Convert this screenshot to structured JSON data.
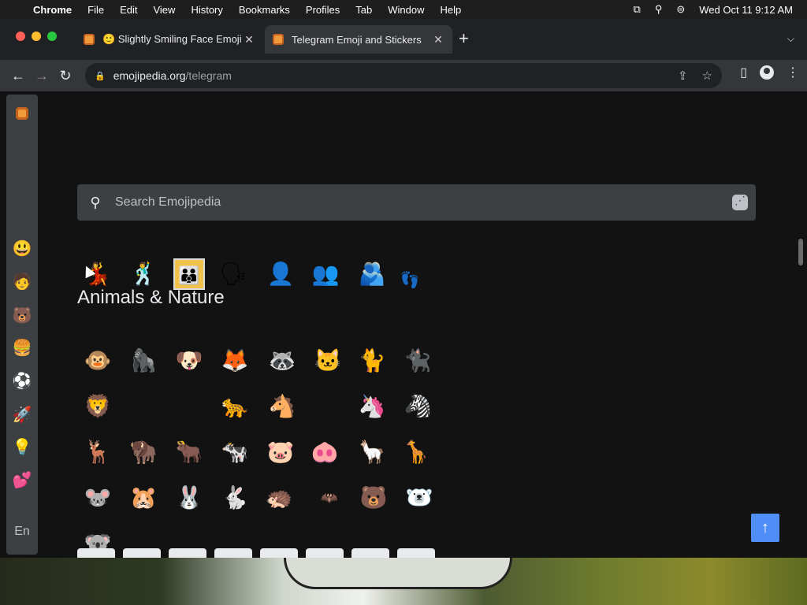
{
  "menubar": {
    "app_name": "Chrome",
    "items": [
      "File",
      "Edit",
      "View",
      "History",
      "Bookmarks",
      "Profiles",
      "Tab",
      "Window",
      "Help"
    ],
    "datetime": "Wed Oct 11  9:12 AM"
  },
  "tabs": [
    {
      "emoji": "🙂",
      "title": "Slightly Smiling Face Emoji",
      "close": "✕",
      "active": false
    },
    {
      "emoji": "",
      "title": "Telegram Emoji and Stickers",
      "close": "✕",
      "active": true
    }
  ],
  "newtab_label": "+",
  "address": {
    "domain": "emojipedia.org",
    "path": "/telegram"
  },
  "search": {
    "placeholder": "Search Emojipedia"
  },
  "sidebar": {
    "categories": [
      "😃",
      "🧑",
      "🐻",
      "🍔",
      "⚽",
      "🚀",
      "💡",
      "💕"
    ],
    "language": "En"
  },
  "people_row": [
    "💃",
    "🕺",
    "👪",
    "🗣",
    "👤",
    "👥",
    "🫂",
    "👣"
  ],
  "section": {
    "title": "Animals & Nature"
  },
  "animal_rows": [
    [
      "🐵",
      "🦍",
      "🐶",
      "🦊",
      "🦝",
      "🐱",
      "🐈",
      "🐈‍⬛"
    ],
    [
      "🦁",
      "",
      "",
      "🐆",
      "🐴",
      "",
      "🦄",
      "🦓"
    ],
    [
      "🦌",
      "🦬",
      "🐂",
      "🐄",
      "🐷",
      "🐽",
      "🦙",
      "🦒"
    ],
    [
      "🐭",
      "🐹",
      "🐰",
      "🐇",
      "🦔",
      "🦇",
      "🐻",
      "🐻‍❄️"
    ],
    [
      "🐨"
    ]
  ],
  "scroll_top_label": "↑"
}
